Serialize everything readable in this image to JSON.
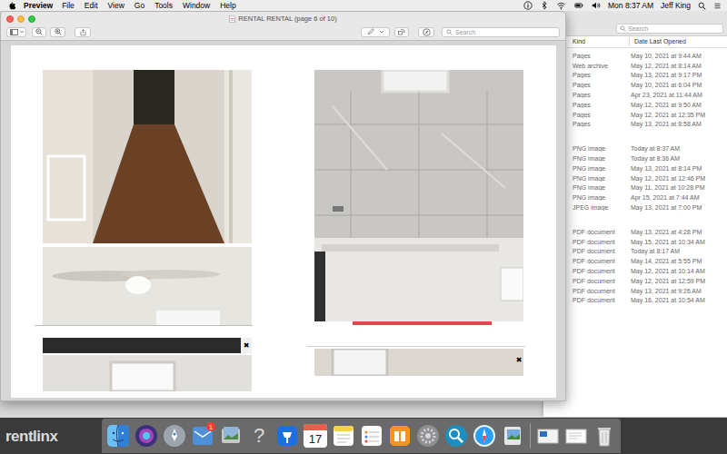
{
  "menubar": {
    "app": "Preview",
    "menus": [
      "File",
      "Edit",
      "View",
      "Go",
      "Tools",
      "Window",
      "Help"
    ],
    "clock": "Mon 8:37 AM",
    "user": "Jeff King"
  },
  "preview": {
    "title": "RENTAL RENTAL (page 6 of 10)",
    "search": {
      "placeholder": "Search"
    },
    "page_marks": [
      "✖",
      "✖"
    ]
  },
  "finder": {
    "search": {
      "placeholder": "Search"
    },
    "columns": [
      "Kind",
      "Date Last Opened"
    ],
    "groups": [
      [
        {
          "kind": "Pages",
          "date": "May 10, 2021 at 9:44 AM"
        },
        {
          "kind": "Web archive",
          "date": "May 12, 2021 at 8:14 AM"
        },
        {
          "kind": "Pages",
          "date": "May 13, 2021 at 9:17 PM"
        },
        {
          "kind": "Pages",
          "date": "May 10, 2021 at 6:04 PM"
        },
        {
          "kind": "Pages",
          "date": "Apr 23, 2021 at 11:44 AM"
        },
        {
          "kind": "Pages",
          "date": "May 12, 2021 at 9:50 AM"
        },
        {
          "kind": "Pages",
          "date": "May 12, 2021 at 12:35 PM"
        },
        {
          "kind": "Pages",
          "date": "May 13, 2021 at 8:58 AM"
        }
      ],
      [
        {
          "kind": "PNG image",
          "date": "Today at 8:37 AM"
        },
        {
          "kind": "PNG image",
          "date": "Today at 8:36 AM"
        },
        {
          "kind": "PNG image",
          "date": "May 13, 2021 at 8:14 PM"
        },
        {
          "kind": "PNG image",
          "date": "May 12, 2021 at 12:46 PM"
        },
        {
          "kind": "PNG image",
          "date": "May 11, 2021 at 10:28 PM"
        },
        {
          "kind": "PNG image",
          "date": "Apr 15, 2021 at 7:44 AM"
        },
        {
          "kind": "JPEG image",
          "date": "May 13, 2021 at 7:00 PM"
        }
      ],
      [
        {
          "kind": "PDF document",
          "date": "May 13, 2021 at 4:28 PM"
        },
        {
          "kind": "PDF document",
          "date": "May 15, 2021 at 10:34 AM"
        },
        {
          "kind": "PDF document",
          "date": "Today at 8:17 AM"
        },
        {
          "kind": "PDF document",
          "date": "May 14, 2021 at 5:55 PM"
        },
        {
          "kind": "PDF document",
          "date": "May 12, 2021 at 10:14 AM"
        },
        {
          "kind": "PDF document",
          "date": "May 12, 2021 at 12:59 PM"
        },
        {
          "kind": "PDF document",
          "date": "May 13, 2021 at 9:26 AM"
        },
        {
          "kind": "PDF document",
          "date": "May 16, 2021 at 10:54 AM"
        }
      ]
    ]
  },
  "desktop": {
    "logo": "rentlinx"
  },
  "dock": {
    "mail_badge": "1",
    "help_glyph": "?",
    "calendar_day": "17"
  }
}
